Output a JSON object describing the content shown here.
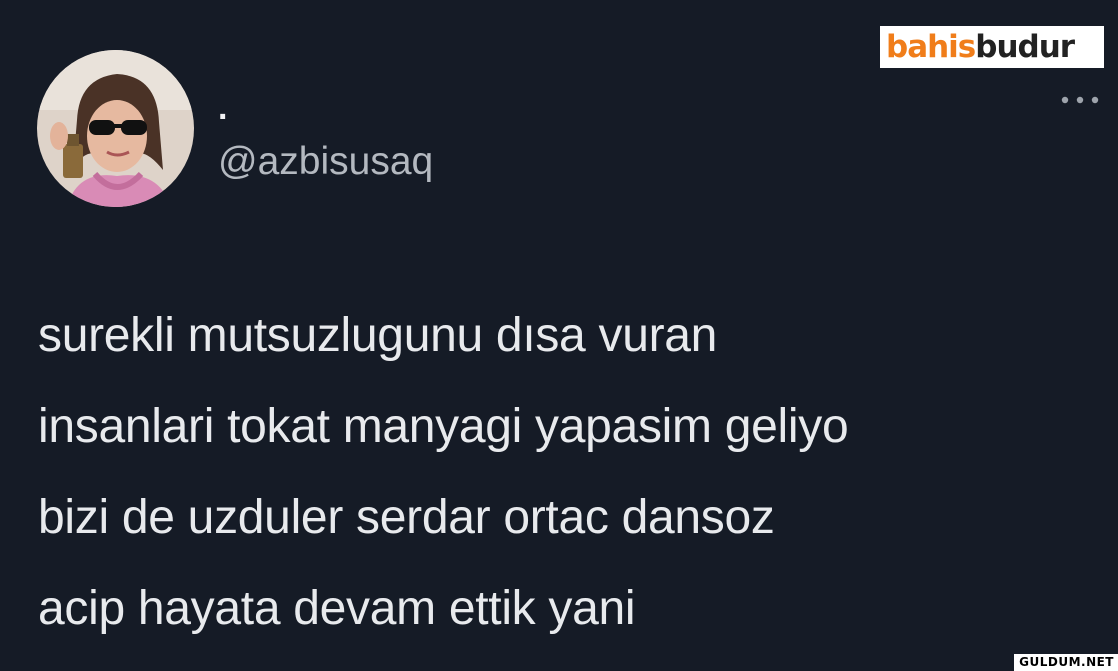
{
  "tweet": {
    "display_name": ".",
    "handle": "@azbisusaq",
    "lines": [
      "surekli mutsuzlugunu dısa vuran",
      "insanlari tokat manyagi yapasim geliyo",
      "bizi de uzduler serdar ortac dansoz",
      "acip hayata devam ettik yani"
    ],
    "more_icon": "more-horizontal-icon"
  },
  "overlay": {
    "brand_logo": "bahisbudur",
    "watermark": "GULDUM.NET"
  },
  "colors": {
    "background": "#151b26",
    "text": "#e8eaed",
    "secondary_text": "#b4b9c0",
    "brand_orange": "#f07d1a"
  }
}
